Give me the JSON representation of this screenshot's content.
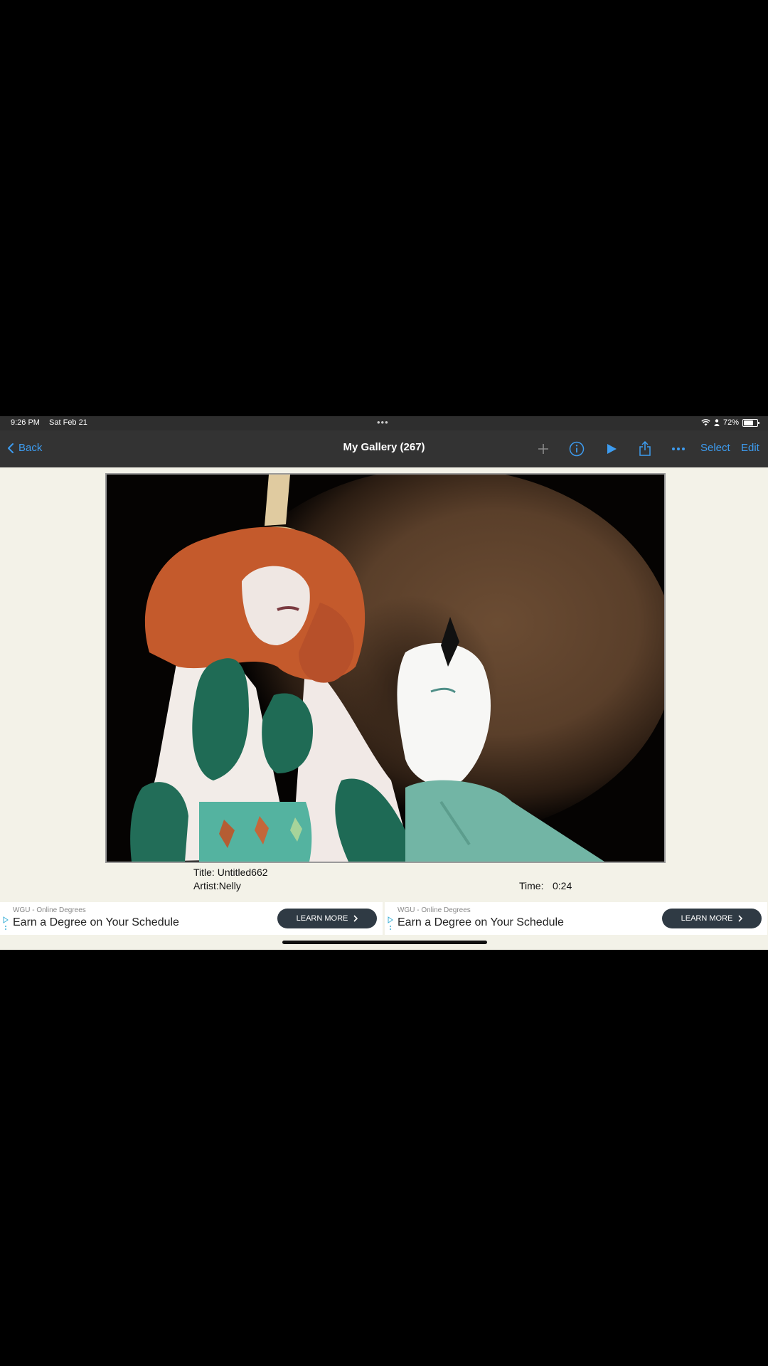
{
  "status": {
    "time": "9:26 PM",
    "date": "Sat Feb 21",
    "battery": "72%",
    "battery_level": 0.72
  },
  "nav": {
    "back_label": "Back",
    "title": "My Gallery (267)",
    "select_label": "Select",
    "edit_label": "Edit",
    "icons": [
      "plus-icon",
      "info-icon",
      "play-icon",
      "share-icon",
      "more-icon"
    ],
    "accent": "#3d9cf0"
  },
  "artwork": {
    "title_line": "Title: Untitled662",
    "artist_line": "Artist:Nelly",
    "time_label": "Time:",
    "time_value": "0:24"
  },
  "ads": [
    {
      "sponsor": "WGU - Online Degrees",
      "headline": "Earn a Degree on Your Schedule",
      "cta": "LEARN MORE"
    },
    {
      "sponsor": "WGU - Online Degrees",
      "headline": "Earn a Degree on Your Schedule",
      "cta": "LEARN MORE"
    }
  ]
}
